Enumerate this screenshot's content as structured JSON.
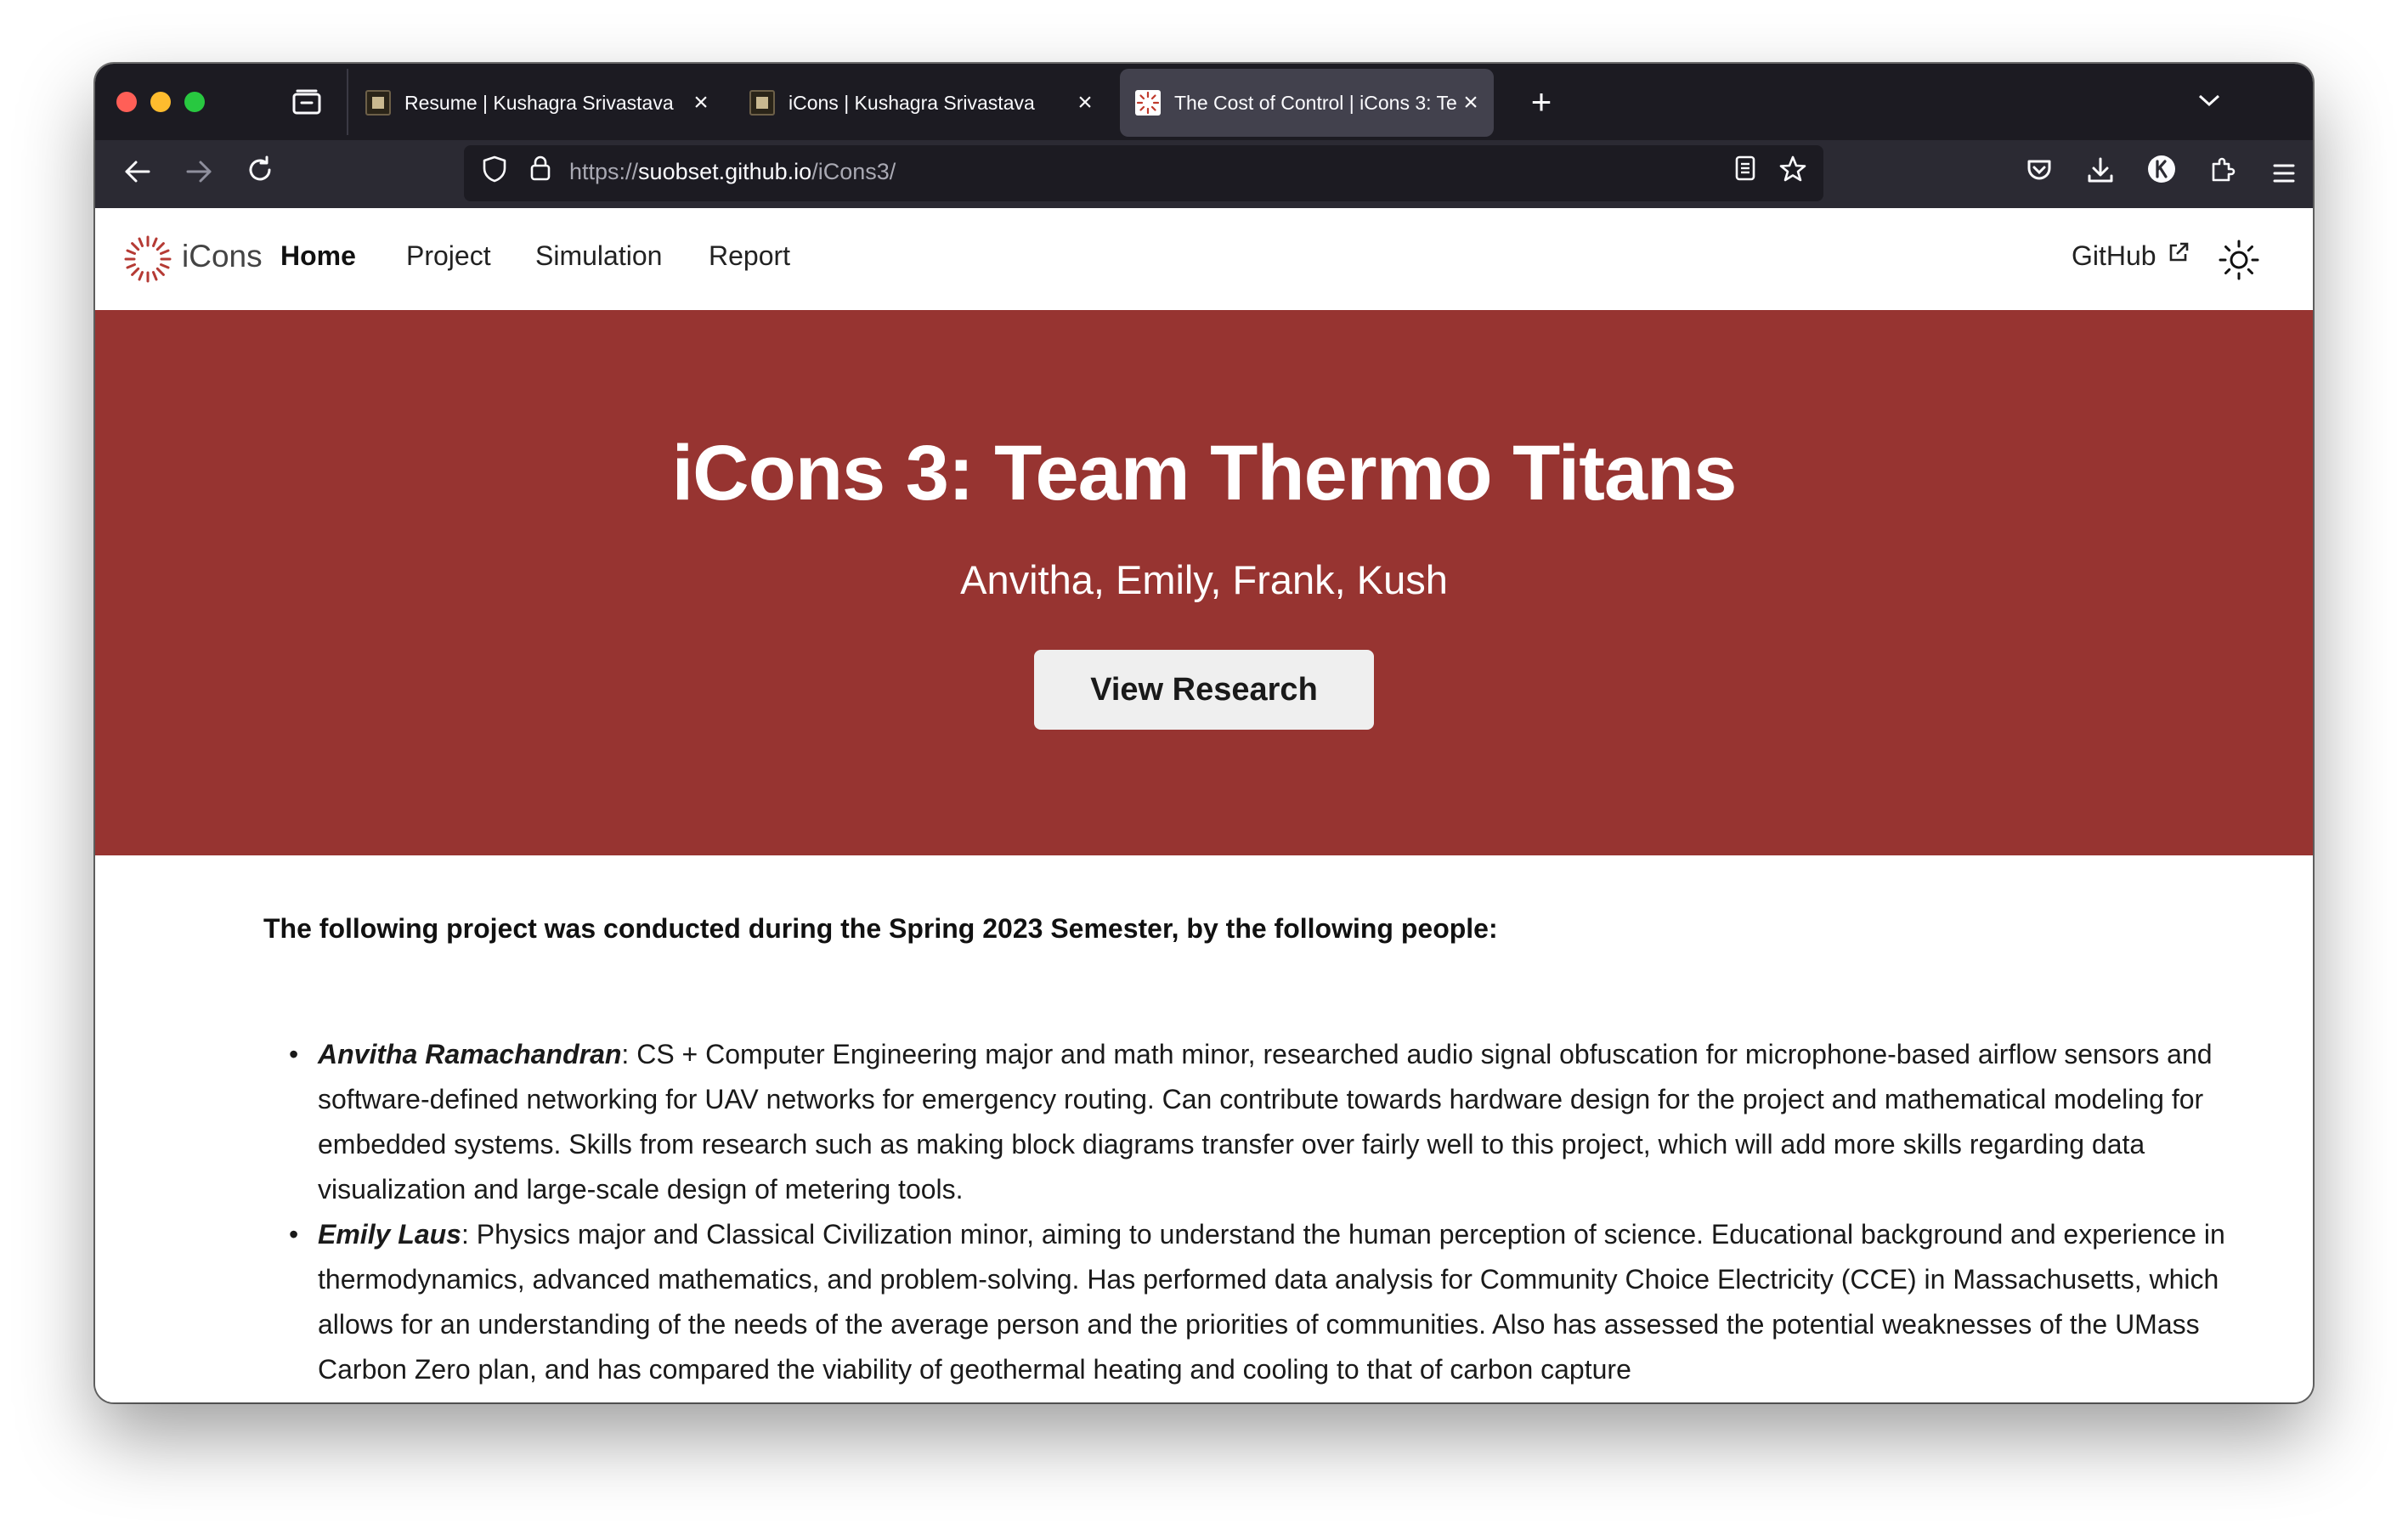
{
  "browser": {
    "tabs": [
      {
        "title": "Resume | Kushagra Srivastava",
        "active": false
      },
      {
        "title": "iCons | Kushagra Srivastava",
        "active": false
      },
      {
        "title": "The Cost of Control | iCons 3: Te",
        "active": true
      }
    ],
    "new_tab_label": "+",
    "url": {
      "scheme": "https://",
      "host": "suobset.github.io",
      "path": "/iCons3/"
    }
  },
  "site": {
    "brand": "iCons",
    "nav": [
      {
        "label": "Home",
        "active": true
      },
      {
        "label": "Project",
        "active": false
      },
      {
        "label": "Simulation",
        "active": false
      },
      {
        "label": "Report",
        "active": false
      }
    ],
    "github_label": "GitHub",
    "hero": {
      "title": "iCons 3: Team Thermo Titans",
      "subtitle": "Anvitha, Emily, Frank, Kush",
      "button_label": "View Research",
      "background": "#973431"
    },
    "intro": "The following project was conducted during the Spring 2023 Semester, by the following people:",
    "people": [
      {
        "name": "Anvitha Ramachandran",
        "description": ": CS + Computer Engineering major and math minor, researched audio signal obfuscation for microphone-based airflow sensors and software-defined networking for UAV networks for emergency routing. Can contribute towards hardware design for the project and mathematical modeling for embedded systems. Skills from research such as making block diagrams transfer over fairly well to this project, which will add more skills regarding data visualization and large-scale design of metering tools."
      },
      {
        "name": "Emily Laus",
        "description": ": Physics major and Classical Civilization minor, aiming to understand the human perception of science. Educational background and experience in thermodynamics, advanced mathematics, and problem-solving. Has performed data analysis for Community Choice Electricity (CCE) in Massachusetts, which allows for an understanding of the needs of the average person and the priorities of communities. Also has assessed the potential weaknesses of the UMass Carbon Zero plan, and has compared the viability of geothermal heating and cooling to that of carbon capture"
      }
    ]
  }
}
